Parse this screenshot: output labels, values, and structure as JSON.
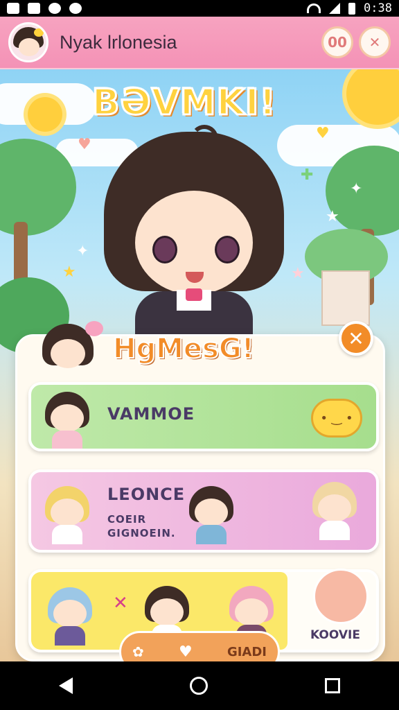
{
  "status_bar": {
    "time": "0:38"
  },
  "header": {
    "title": "Nyak lrlonesia",
    "btn1_label": "00",
    "btn2_icon": "close-icon"
  },
  "scene": {
    "banner": "BƏVMKI!"
  },
  "panel": {
    "title": "HgMesG!",
    "close_icon": "close-icon",
    "cards": [
      {
        "label": "VAMMOE"
      },
      {
        "label": "LEONCE",
        "sublabel": "COEIR GIGNOEIN."
      },
      {
        "label": "",
        "pill_label": "GIADI",
        "side_label": "KOOVIE"
      }
    ]
  },
  "nav": {
    "back": "back-icon",
    "home": "home-icon",
    "recent": "recent-apps-icon"
  },
  "colors": {
    "header_pink": "#f492b6",
    "accent_orange": "#f28c28",
    "card_green": "#a6de8d",
    "card_pink": "#eaa9dc",
    "card_yellow": "#fbe869"
  }
}
